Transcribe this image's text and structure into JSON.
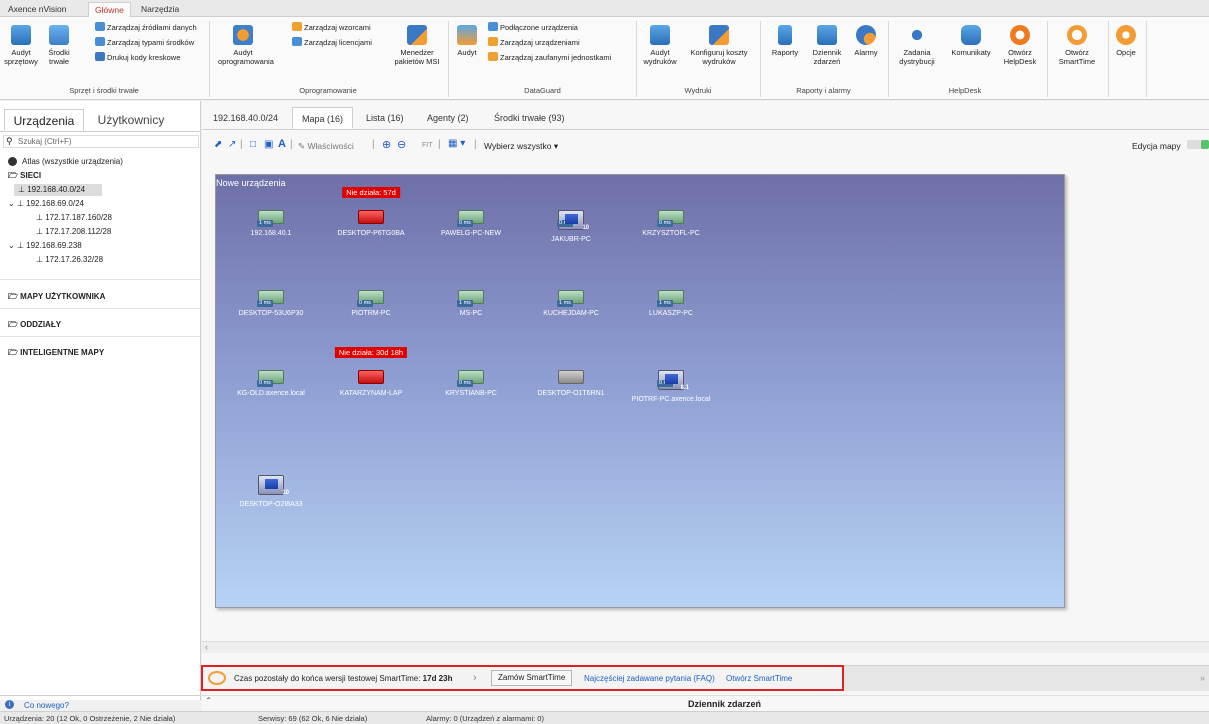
{
  "ribbon_tabs": [
    "Axence nVision",
    "Główne",
    "Narzędzia"
  ],
  "ribbon": {
    "groups": [
      {
        "label": "Sprzęt i środki trwałe"
      },
      {
        "label": "Oprogramowanie"
      },
      {
        "label": "DataGuard"
      },
      {
        "label": "Wydruki"
      },
      {
        "label": "Raporty i alarmy"
      },
      {
        "label": "HelpDesk"
      }
    ],
    "buttons": {
      "audyt_sprzetowy": "Audyt sprzętowy",
      "srodki_trwale": "Środki trwałe",
      "zarzadzaj_zrodlami": "Zarządzaj źródłami danych",
      "zarzadzaj_typami": "Zarządzaj typami środków",
      "drukuj_kody": "Drukuj kody kreskowe",
      "audyt_oprogramowania": "Audyt oprogramowania",
      "zarzadzaj_wzorcami": "Zarządzaj wzorcami",
      "zarzadzaj_licencjami": "Zarządzaj licencjami",
      "menedzer_msi": "Menedżer pakietów MSI",
      "audyt": "Audyt",
      "podlaczone_urzadzenia": "Podłączone urządzenia",
      "zarzadzaj_urzadzeniami": "Zarządzaj urządzeniami",
      "zarzadzaj_zaufanymi": "Zarządzaj zaufanymi jednostkami",
      "audyt_wydrukow": "Audyt wydruków",
      "konfiguruj_koszty": "Konfiguruj koszty wydruków",
      "raporty": "Raporty",
      "dziennik_zdarzen": "Dziennik zdarzeń",
      "alarmy": "Alarmy",
      "zadania_dystrybucji": "Zadania dystrybucji",
      "komunikaty": "Komunikaty",
      "otworz_helpdesk": "Otwórz HelpDesk",
      "otworz_smarttime": "Otwórz SmartTime",
      "opcje": "Opcje"
    }
  },
  "sidebar": {
    "tabs": [
      "Urządzenia",
      "Użytkownicy"
    ],
    "search_placeholder": "Szukaj (Ctrl+F)",
    "atlas": "Atlas (wszystkie urządzenia)",
    "sieci": "SIECI",
    "tree": [
      "192.168.40.0/24",
      "192.168.69.0/24",
      "172.17.187.160/28",
      "172.17.208.112/28",
      "192.168.69.238",
      "172.17.26.32/28"
    ],
    "sections": [
      "MAPY UŻYTKOWNIKA",
      "ODDZIAŁY",
      "INTELIGENTNE MAPY"
    ],
    "whats_new": "Co nowego?"
  },
  "main": {
    "tabs": [
      "192.168.40.0/24",
      "Mapa (16)",
      "Lista (16)",
      "Agenty (2)",
      "Środki trwałe (93)"
    ],
    "toolbar": {
      "wlasciwosci": "Właściwości",
      "fit": "FIT",
      "wybierz": "Wybierz wszystko",
      "edycja": "Edycja mapy"
    },
    "map": {
      "title": "Nowe urządzenia",
      "devices": [
        {
          "name": "192.168.40.1",
          "latency": "1 ms",
          "kind": "ok"
        },
        {
          "name": "DESKTOP-P6TG0BA",
          "latency": "",
          "kind": "down",
          "down": "Nie działa: 57d"
        },
        {
          "name": "PAWELG-PC-NEW",
          "latency": "0 ms",
          "kind": "ok"
        },
        {
          "name": "JAKUBR-PC",
          "latency": "0 ms",
          "kind": "win",
          "badge": "10"
        },
        {
          "name": "KRZYSZTOFL-PC",
          "latency": "0 ms",
          "kind": "ok"
        },
        {
          "name": "DESKTOP-53U6P30",
          "latency": "3 ms",
          "kind": "ok"
        },
        {
          "name": "PIOTRM-PC",
          "latency": "0 ms",
          "kind": "ok"
        },
        {
          "name": "MS-PC",
          "latency": "1 ms",
          "kind": "ok"
        },
        {
          "name": "KUCHEJDAM-PC",
          "latency": "1 ms",
          "kind": "ok"
        },
        {
          "name": "LUKASZP-PC",
          "latency": "1 ms",
          "kind": "ok"
        },
        {
          "name": "KG-OLD.axence.local",
          "latency": "0 ms",
          "kind": "ok"
        },
        {
          "name": "KATARZYNAM-LAP",
          "latency": "",
          "kind": "down",
          "down": "Nie działa: 30d 18h"
        },
        {
          "name": "KRYSTIANB-PC",
          "latency": "0 ms",
          "kind": "ok"
        },
        {
          "name": "DESKTOP-O1T6RN1",
          "latency": "",
          "kind": "gray"
        },
        {
          "name": "PIOTRF-PC.axence.local",
          "latency": "0 ms",
          "kind": "win",
          "badge": "8.1"
        },
        {
          "name": "DESKTOP-O2I8A33",
          "latency": "",
          "kind": "win",
          "badge": "10"
        }
      ]
    }
  },
  "smarttime": {
    "text": "Czas pozostały do końca wersji testowej SmartTime:",
    "days": "17d 23h",
    "order": "Zamów SmartTime",
    "faq": "Najczęściej zadawane pytania (FAQ)",
    "open": "Otwórz SmartTime"
  },
  "event_log": "Dziennik zdarzeń",
  "status": {
    "devices": "Urządzenia: 20 (12 Ok, 0 Ostrzeżenie, 2 Nie działa)",
    "services": "Serwisy: 69 (62 Ok, 6 Nie działa)",
    "alarms": "Alarmy: 0 (Urządzeń z alarmami: 0)"
  },
  "colors": {
    "accent": "#c0392b",
    "down": "#e00000",
    "highlight": "#e02020",
    "link": "#1e5fc8"
  }
}
